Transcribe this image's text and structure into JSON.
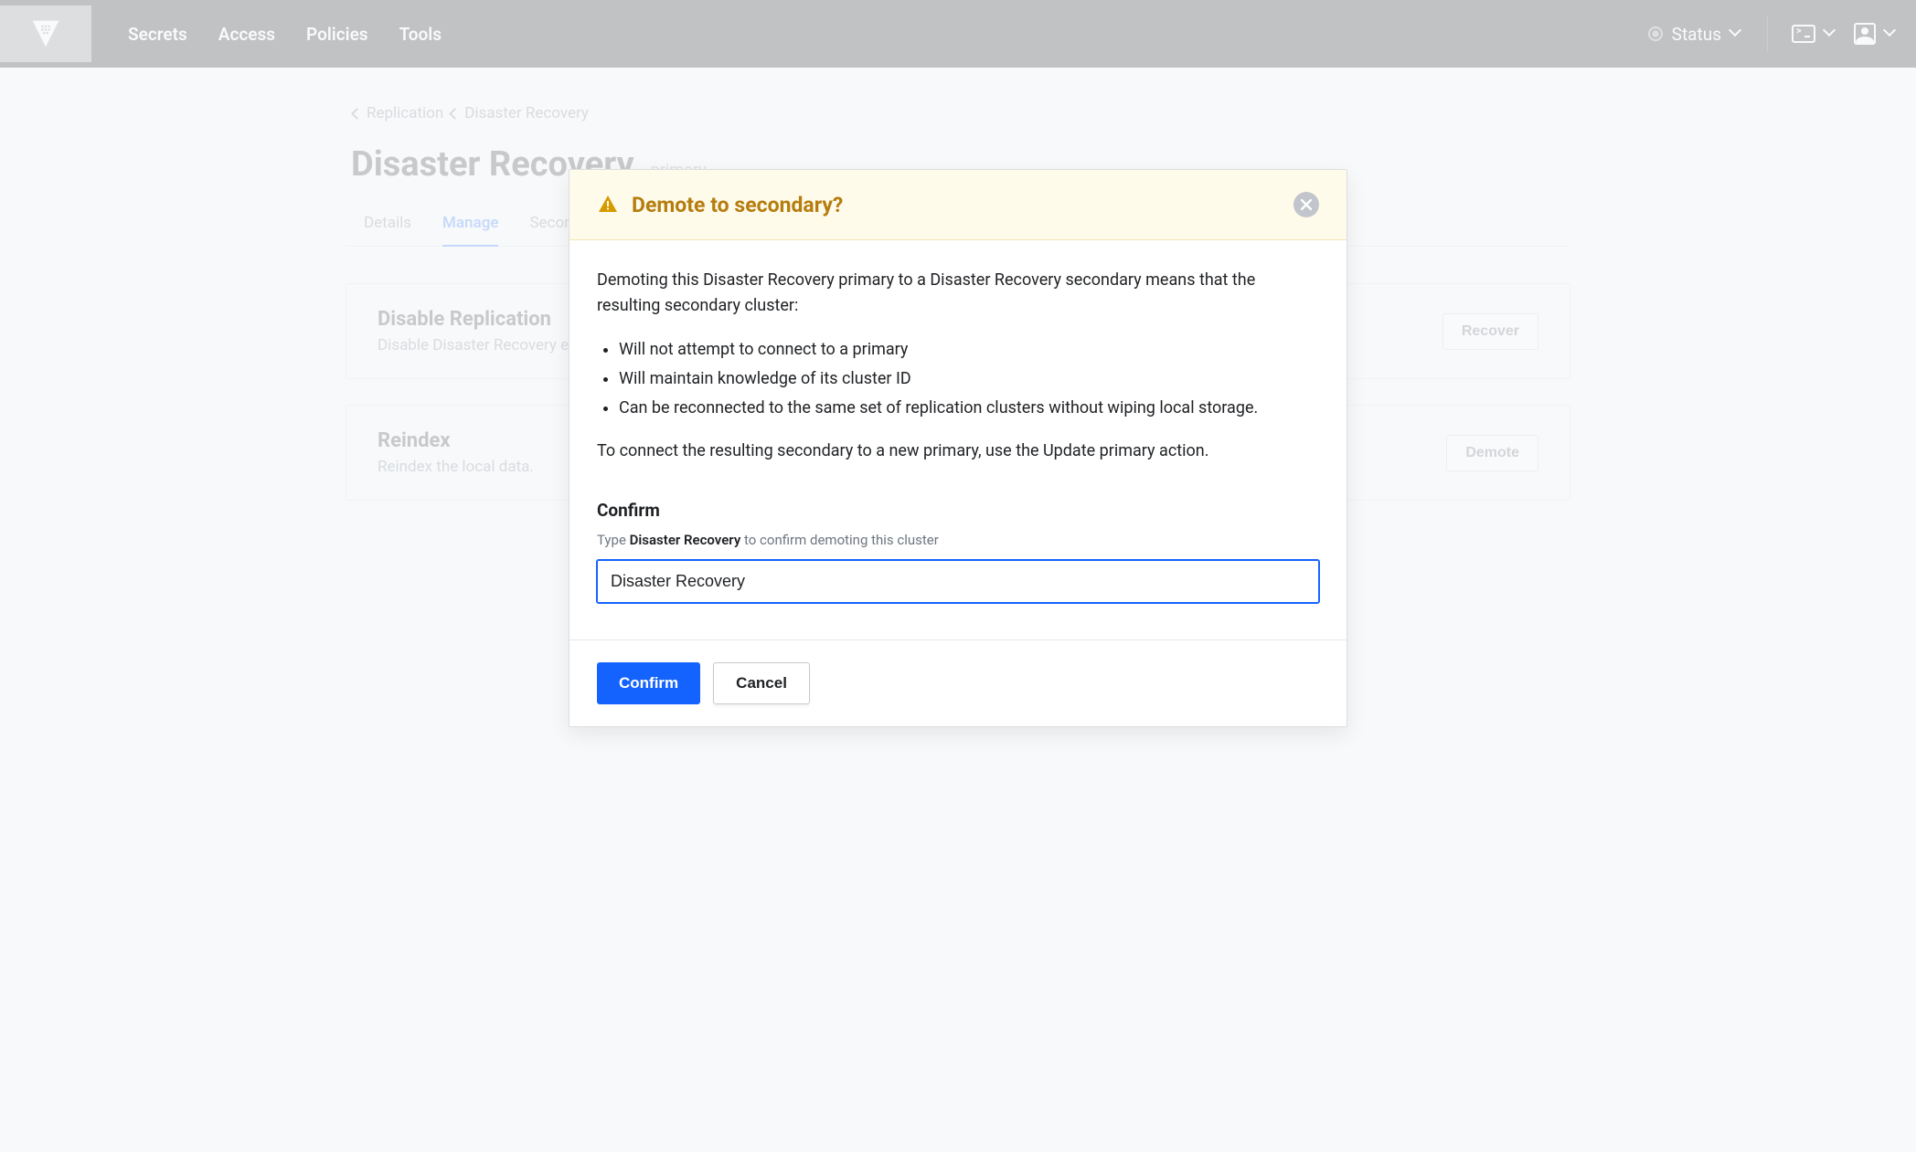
{
  "nav": {
    "links": [
      "Secrets",
      "Access",
      "Policies",
      "Tools"
    ],
    "status_label": "Status"
  },
  "breadcrumbs": {
    "items": [
      "Replication",
      "Disaster Recovery"
    ]
  },
  "page": {
    "title": "Disaster Recovery",
    "badge": "primary",
    "tabs": [
      "Details",
      "Manage",
      "Secondaries"
    ],
    "active_tab_index": 1
  },
  "cards": [
    {
      "title": "Disable Replication",
      "desc": "Disable Disaster Recovery entirely on the cluster.",
      "button": "Recover"
    },
    {
      "title": "Reindex",
      "desc": "Reindex the local data.",
      "button": "Demote"
    }
  ],
  "modal": {
    "title": "Demote to secondary?",
    "intro": "Demoting this Disaster Recovery primary to a Disaster Recovery secondary means that the resulting secondary cluster:",
    "bullets": [
      "Will not attempt to connect to a primary",
      "Will maintain knowledge of its cluster ID",
      "Can be reconnected to the same set of replication clusters without wiping local storage."
    ],
    "outro": "To connect the resulting secondary to a new primary, use the Update primary action.",
    "confirm_heading": "Confirm",
    "confirm_hint_prefix": "Type ",
    "confirm_hint_bold": "Disaster Recovery",
    "confirm_hint_suffix": " to confirm demoting this cluster",
    "confirm_value": "Disaster Recovery",
    "confirm_btn": "Confirm",
    "cancel_btn": "Cancel"
  }
}
